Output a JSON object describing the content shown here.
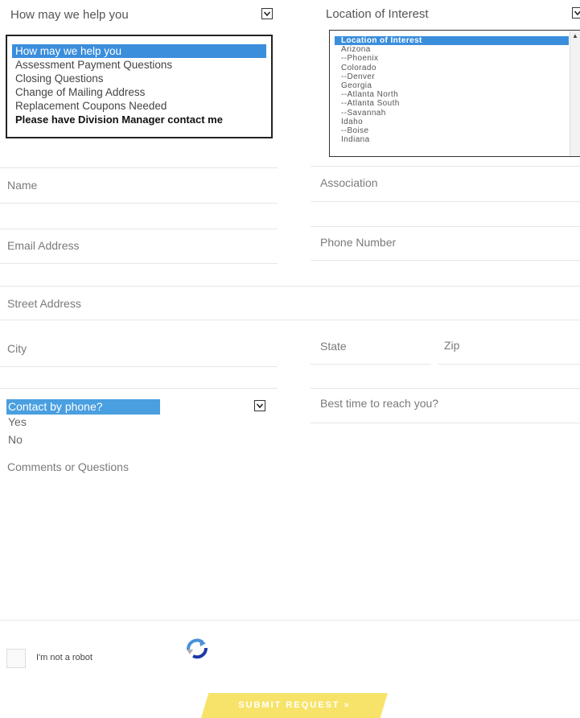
{
  "help_select": {
    "header": "How may we help you",
    "options": [
      "How may we help you",
      "Assessment Payment Questions",
      "Closing Questions",
      "Change of Mailing Address",
      "Replacement Coupons Needed",
      "Please have Division Manager contact me"
    ],
    "selected_index": 0
  },
  "location_select": {
    "header": "Location of Interest",
    "options": [
      "Location of Interest",
      "Arizona",
      "--Phoenix",
      "Colorado",
      "--Denver",
      "Georgia",
      "--Atlanta North",
      "--Atlanta South",
      "--Savannah",
      "Idaho",
      "--Boise",
      "Indiana"
    ],
    "selected_index": 0
  },
  "fields": {
    "name": "Name",
    "association": "Association",
    "email": "Email Address",
    "phone": "Phone Number",
    "street": "Street Address",
    "city": "City",
    "state": "State",
    "zip": "Zip",
    "best_time": "Best time to reach you?",
    "comments": "Comments or Questions"
  },
  "contact_phone": {
    "label": "Contact by phone?",
    "options": [
      "Yes",
      "No"
    ]
  },
  "captcha": {
    "label": "I'm not a robot"
  },
  "submit": {
    "label": "SUBMIT REQUEST »"
  },
  "colors": {
    "selection": "#3a8edc",
    "submit": "#f7e36a"
  }
}
